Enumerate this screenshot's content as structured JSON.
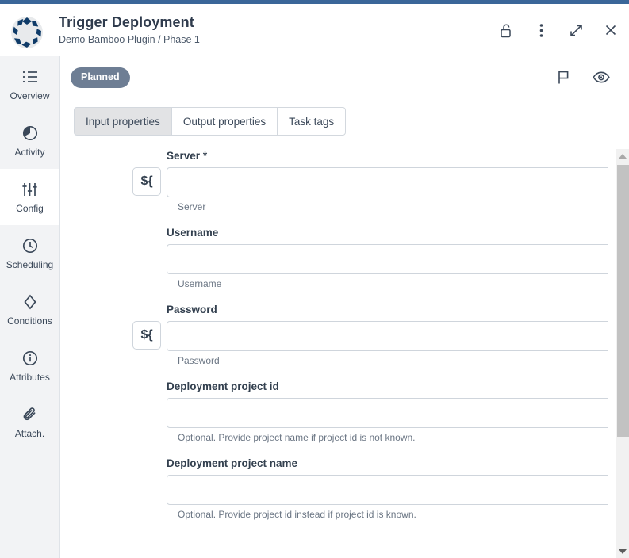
{
  "theme": {
    "accent_bar": "#3a6699",
    "badge_bg": "#6e7e94",
    "text": "#3b4859",
    "sidebar_bg": "#f2f3f5"
  },
  "header": {
    "logo_icon": "segmented-circle-logo",
    "title": "Trigger Deployment",
    "breadcrumb": "Demo Bamboo Plugin / Phase 1",
    "actions": [
      {
        "name": "unlock-icon",
        "label": "Unlock"
      },
      {
        "name": "more-options-icon",
        "label": "More options"
      },
      {
        "name": "expand-icon",
        "label": "Expand"
      },
      {
        "name": "close-icon",
        "label": "Close"
      }
    ]
  },
  "sidebar": {
    "items": [
      {
        "label": "Overview",
        "icon": "list-icon",
        "active": false
      },
      {
        "label": "Activity",
        "icon": "pie-clock-icon",
        "active": false
      },
      {
        "label": "Config",
        "icon": "sliders-icon",
        "active": true
      },
      {
        "label": "Scheduling",
        "icon": "clock-icon",
        "active": false
      },
      {
        "label": "Conditions",
        "icon": "diamond-icon",
        "active": false
      },
      {
        "label": "Attributes",
        "icon": "info-icon",
        "active": false
      },
      {
        "label": "Attach.",
        "icon": "paperclip-icon",
        "active": false
      }
    ]
  },
  "content": {
    "status_badge": "Planned",
    "status_icons": [
      {
        "name": "flag-icon",
        "label": "Flag"
      },
      {
        "name": "eye-icon",
        "label": "Watch"
      }
    ],
    "tabs": [
      {
        "label": "Input properties",
        "active": true
      },
      {
        "label": "Output properties",
        "active": false
      },
      {
        "label": "Task tags",
        "active": false
      }
    ],
    "fields": [
      {
        "label": "Server",
        "required": true,
        "required_mark": "*",
        "has_variable_button": true,
        "variable_button_label": "${",
        "control": "select",
        "value": "",
        "placeholder": "",
        "hint": "Server"
      },
      {
        "label": "Username",
        "required": false,
        "required_mark": "",
        "has_variable_button": false,
        "variable_button_label": "",
        "control": "text",
        "value": "",
        "placeholder": "",
        "hint": "Username"
      },
      {
        "label": "Password",
        "required": false,
        "required_mark": "",
        "has_variable_button": true,
        "variable_button_label": "${",
        "control": "text",
        "value": "",
        "placeholder": "",
        "hint": "Password"
      },
      {
        "label": "Deployment project id",
        "required": false,
        "required_mark": "",
        "has_variable_button": false,
        "variable_button_label": "",
        "control": "text",
        "value": "",
        "placeholder": "",
        "hint": "Optional. Provide project name if project id is not known."
      },
      {
        "label": "Deployment project name",
        "required": false,
        "required_mark": "",
        "has_variable_button": false,
        "variable_button_label": "",
        "control": "text",
        "value": "",
        "placeholder": "",
        "hint": "Optional. Provide project id instead if project id is known."
      }
    ]
  },
  "scrollbar": {
    "up_arrow_icon": "scroll-up-arrow-icon",
    "down_arrow_icon": "scroll-down-arrow-icon",
    "thumb_top_pct": 4,
    "thumb_height_pct": 66
  }
}
